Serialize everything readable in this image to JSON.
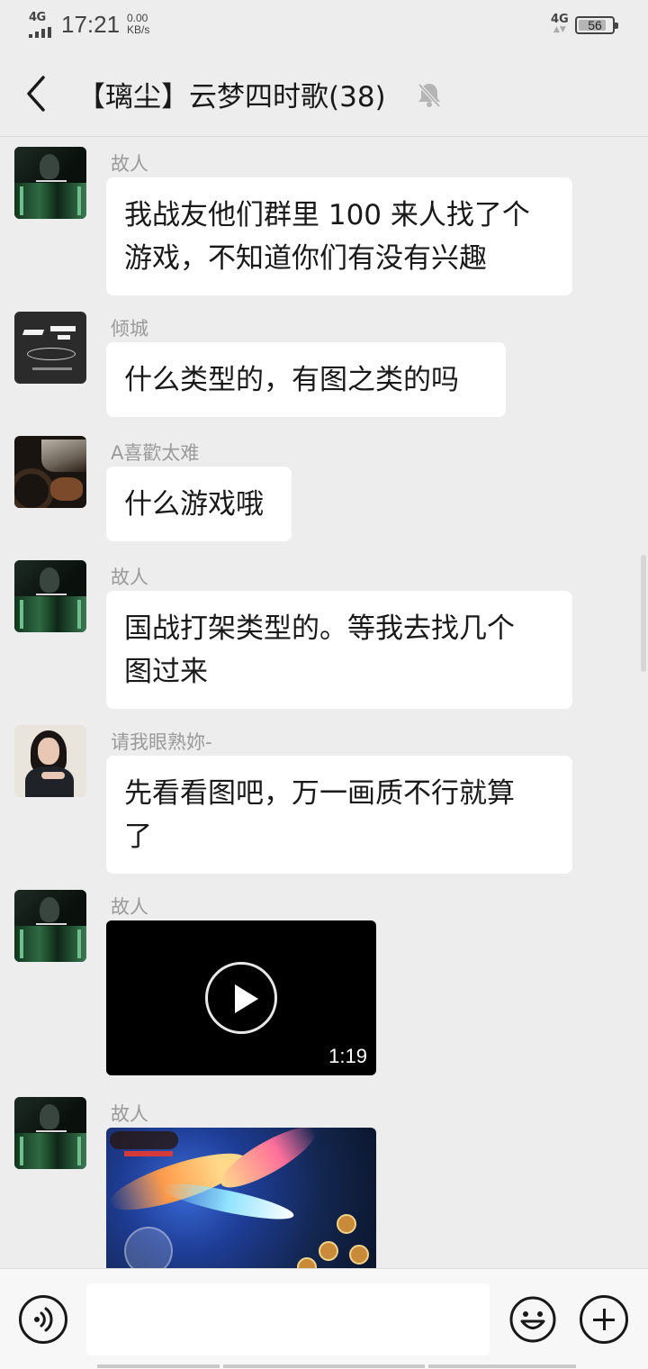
{
  "status_bar": {
    "network": "4G",
    "time": "17:21",
    "speed_value": "0.00",
    "speed_unit": "KB/s",
    "right_network": "4G",
    "battery": "56"
  },
  "header": {
    "title": "【璃尘】云梦四时歌(38)",
    "back_icon": "chevron-left-icon",
    "mute_icon": "bell-off-icon"
  },
  "messages": [
    {
      "sender": "故人",
      "text_line1": "我战友他们群里 100 来人找了个",
      "text_line2": "游戏，不知道你们有没有兴趣"
    },
    {
      "sender": "倾城",
      "text": "什么类型的，有图之类的吗"
    },
    {
      "sender": "A喜歡太难",
      "text": "什么游戏哦"
    },
    {
      "sender": "故人",
      "text_line1": "国战打架类型的。等我去找几个",
      "text_line2": "图过来"
    },
    {
      "sender": "请我眼熟妳-",
      "text_line1": "先看看图吧，万一画质不行就算",
      "text_line2": "了"
    },
    {
      "sender": "故人",
      "type": "video",
      "duration": "1:19"
    },
    {
      "sender": "故人",
      "type": "image"
    }
  ],
  "input_bar": {
    "voice_icon": "voice-icon",
    "emoji_icon": "emoji-icon",
    "plus_icon": "plus-icon",
    "text_value": ""
  }
}
